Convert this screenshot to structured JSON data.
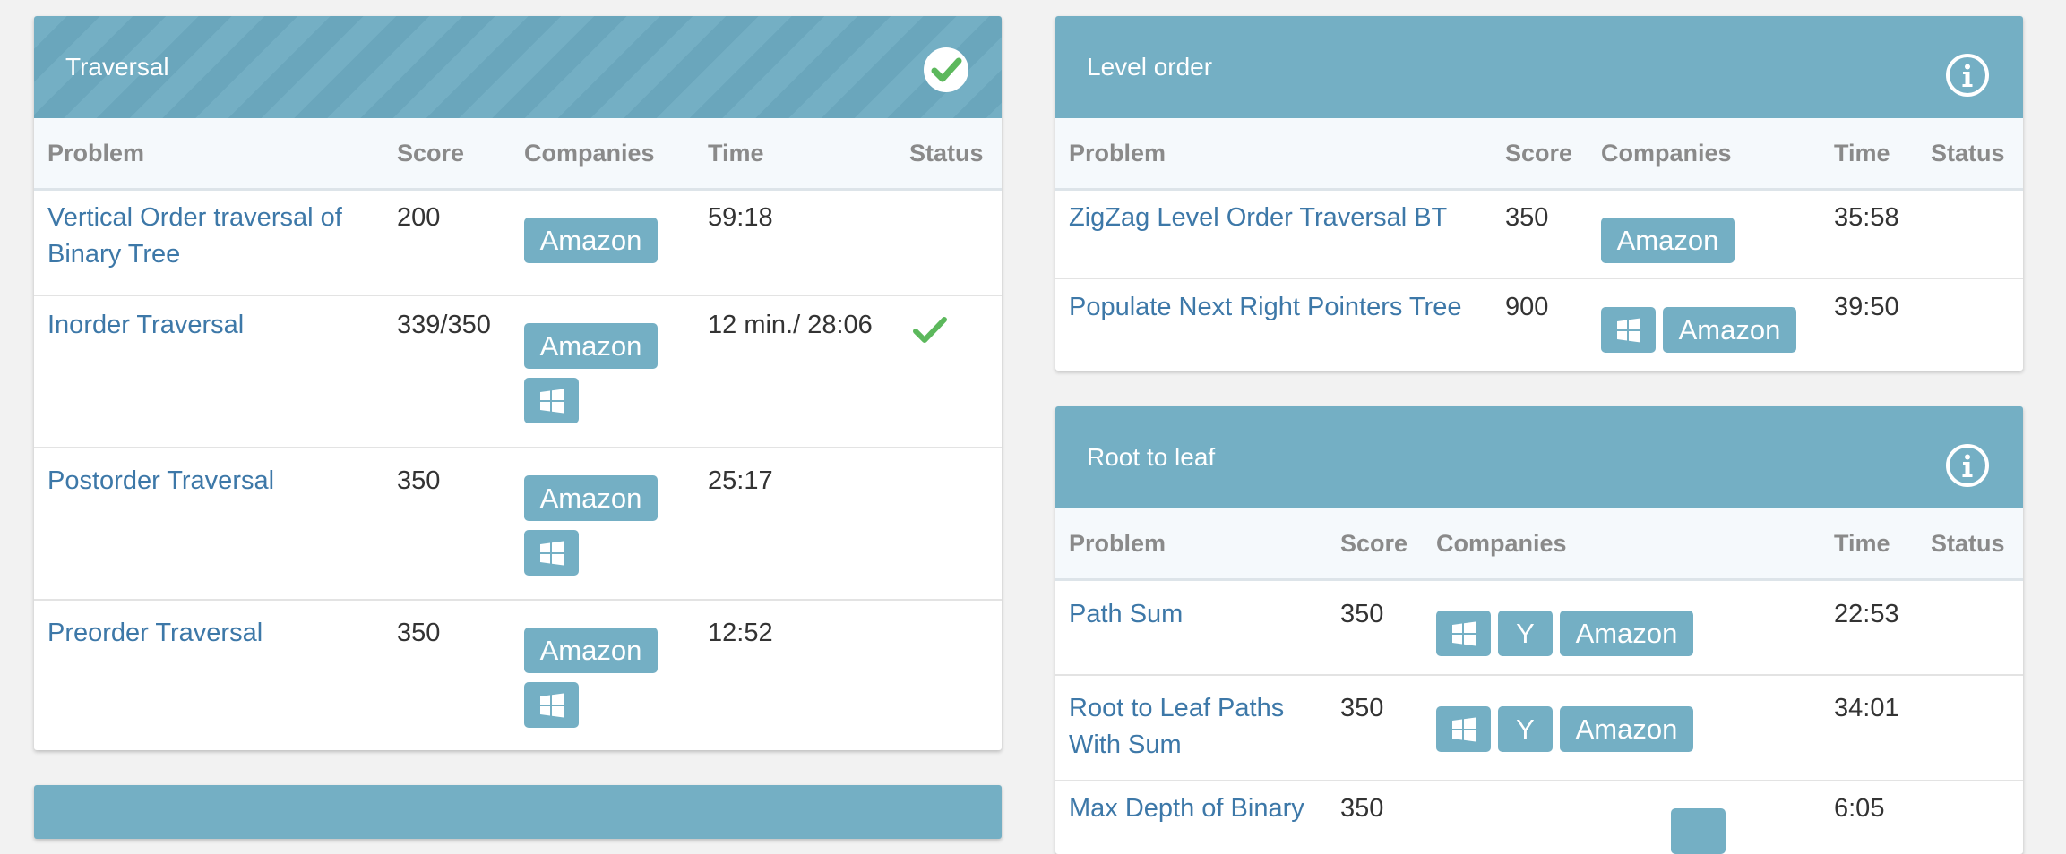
{
  "columns": {
    "problem": "Problem",
    "score": "Score",
    "companies": "Companies",
    "time": "Time",
    "status": "Status"
  },
  "company_labels": {
    "amazon": "Amazon",
    "yahoo": "Y"
  },
  "traversal": {
    "title": "Traversal",
    "status": "completed",
    "rows": [
      {
        "problem": "Vertical Order traversal of Binary Tree",
        "score": "200",
        "companies": [
          "amazon"
        ],
        "time": "59:18",
        "status": ""
      },
      {
        "problem": "Inorder Traversal",
        "score": "339/350",
        "companies": [
          "amazon",
          "windows"
        ],
        "time": "12 min./ 28:06",
        "status": "solved"
      },
      {
        "problem": "Postorder Traversal",
        "score": "350",
        "companies": [
          "amazon",
          "windows"
        ],
        "time": "25:17",
        "status": ""
      },
      {
        "problem": "Preorder Traversal",
        "score": "350",
        "companies": [
          "amazon",
          "windows"
        ],
        "time": "12:52",
        "status": ""
      }
    ]
  },
  "level_order": {
    "title": "Level order",
    "rows": [
      {
        "problem": "ZigZag Level Order Traversal BT",
        "score": "350",
        "companies": [
          "amazon"
        ],
        "time": "35:58",
        "status": ""
      },
      {
        "problem": "Populate Next Right Pointers Tree",
        "score": "900",
        "companies": [
          "windows",
          "amazon"
        ],
        "time": "39:50",
        "status": ""
      }
    ]
  },
  "root_to_leaf": {
    "title": "Root to leaf",
    "rows": [
      {
        "problem": "Path Sum",
        "score": "350",
        "companies": [
          "windows",
          "yahoo",
          "amazon"
        ],
        "time": "22:53",
        "status": ""
      },
      {
        "problem": "Root to Leaf Paths With Sum",
        "score": "350",
        "companies": [
          "windows",
          "yahoo",
          "amazon"
        ],
        "time": "34:01",
        "status": ""
      },
      {
        "problem": "Max Depth of Binary",
        "score": "350",
        "companies": [
          "amazon"
        ],
        "time": "6:05",
        "status": ""
      }
    ]
  },
  "colors": {
    "header": "#74afc4",
    "link": "#3d78a8",
    "check": "#5cb85c"
  }
}
